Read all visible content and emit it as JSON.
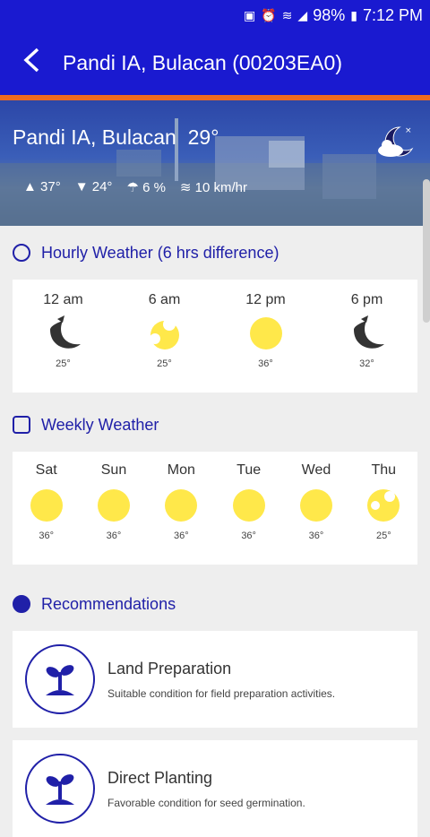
{
  "status_bar": {
    "battery": "98%",
    "time": "7:12 PM"
  },
  "app_bar": {
    "title": "Pandi IA, Bulacan (00203EA0)",
    "back_icon": "back-chevron-icon"
  },
  "current": {
    "location": "Pandi IA, Bulacan",
    "temperature": "29°",
    "high": "37°",
    "low": "24°",
    "rain_chance": "6 %",
    "wind": "10 km/hr",
    "condition_icon": "night-cloud-icon"
  },
  "hourly": {
    "title": "Hourly Weather (6 hrs difference)",
    "items": [
      {
        "time": "12 am",
        "icon": "moon-icon",
        "temp": "25°"
      },
      {
        "time": "6 am",
        "icon": "partly-sunny-icon",
        "temp": "25°"
      },
      {
        "time": "12 pm",
        "icon": "sun-icon",
        "temp": "36°"
      },
      {
        "time": "6 pm",
        "icon": "moon-icon",
        "temp": "32°"
      }
    ]
  },
  "weekly": {
    "title": "Weekly Weather",
    "items": [
      {
        "day": "Sat",
        "icon": "sun-icon",
        "temp": "36°"
      },
      {
        "day": "Sun",
        "icon": "sun-icon",
        "temp": "36°"
      },
      {
        "day": "Mon",
        "icon": "sun-icon",
        "temp": "36°"
      },
      {
        "day": "Tue",
        "icon": "sun-icon",
        "temp": "36°"
      },
      {
        "day": "Wed",
        "icon": "sun-icon",
        "temp": "36°"
      },
      {
        "day": "Thu",
        "icon": "partly-sunny-icon",
        "temp": "25°"
      }
    ]
  },
  "recommendations": {
    "title": "Recommendations",
    "items": [
      {
        "title": "Land Preparation",
        "desc": "Suitable condition for field preparation activities.",
        "icon": "plant-sprout-icon"
      },
      {
        "title": "Direct Planting",
        "desc": "Favorable condition for seed germination.",
        "icon": "plant-sprout-icon"
      }
    ]
  },
  "colors": {
    "primary": "#1a1ad0",
    "accent": "#f06a1f",
    "section_text": "#2020a8",
    "sun": "#ffe84a"
  }
}
